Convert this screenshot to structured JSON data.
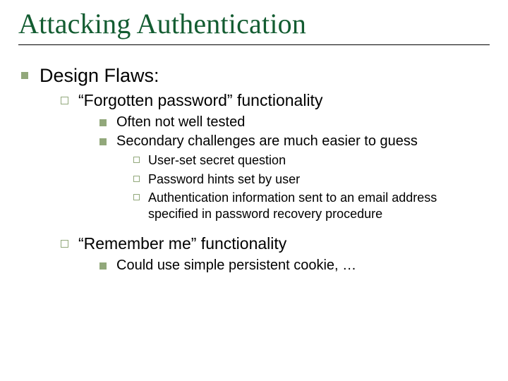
{
  "title": "Attacking Authentication",
  "lvl1": {
    "a": "Design Flaws:"
  },
  "lvl2": {
    "a": "“Forgotten password” functionality",
    "b": "“Remember me” functionality"
  },
  "lvl3": {
    "a": "Often not well tested",
    "b": "Secondary challenges are much easier to guess",
    "c": "Could use simple persistent cookie, …"
  },
  "lvl4": {
    "a": "User-set secret question",
    "b": "Password hints set by user",
    "c": "Authentication information sent to an email address specified in password recovery procedure"
  }
}
